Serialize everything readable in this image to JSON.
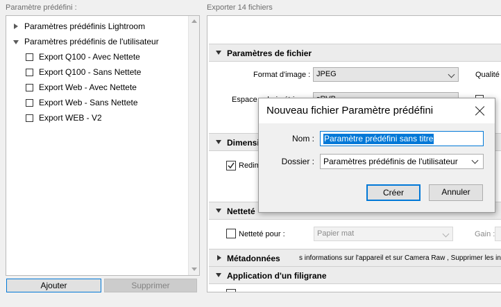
{
  "left": {
    "header": "Paramètre prédéfini :",
    "tree": [
      {
        "label": "Paramètres prédéfinis Lightroom",
        "expanded": false
      },
      {
        "label": "Paramètres prédéfinis de l'utilisateur",
        "expanded": true,
        "children": [
          "Export Q100 - Avec Nettete",
          "Export Q100 - Sans Nettete",
          "Export Web - Avec Nettete",
          "Export Web - Sans Nettete",
          "Export WEB - V2"
        ]
      }
    ],
    "add_label": "Ajouter",
    "remove_label": "Supprimer"
  },
  "right": {
    "header": "Exporter 14 fichiers",
    "sections": {
      "file_settings": "Paramètres de fichier",
      "dimensions": "Dimensi",
      "sharpening": "Netteté",
      "metadata": "Métadonnées",
      "watermark": "Application d'un filigrane"
    },
    "image_format_label": "Format d'image :",
    "image_format_value": "JPEG",
    "quality_label": "Qualité",
    "color_space_label": "Espace colorimétrique",
    "color_space_value": "sRVB",
    "resize_label": "Redim",
    "sharpen_for_label": "Netteté pour :",
    "sharpen_for_value": "Papier mat",
    "gain_label": "Gain :",
    "metadata_desc": "s informations sur l'appareil et sur Camera Raw , Supprimer les info"
  },
  "dialog": {
    "title": "Nouveau fichier Paramètre prédéfini",
    "name_label": "Nom :",
    "name_value": "Paramètre prédéfini sans titre",
    "folder_label": "Dossier :",
    "folder_value": "Paramètres prédéfinis de l'utilisateur",
    "create_label": "Créer",
    "cancel_label": "Annuler"
  },
  "colors": {
    "accent": "#0078d7",
    "window_bg": "#f0f0f0"
  }
}
